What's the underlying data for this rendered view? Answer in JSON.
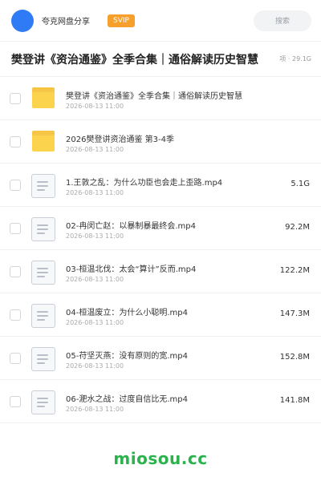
{
  "header": {
    "sharer_name": "夸克网盘分享",
    "vip_badge": "SVIP",
    "search_placeholder": "搜索",
    "avatar_color": "#2f7bf6"
  },
  "share": {
    "title": "樊登讲《资治通鉴》全季合集｜通俗解读历史智慧",
    "meta": "项 · 29.1G"
  },
  "files": [
    {
      "type": "folder",
      "icon": "folder-icon",
      "name": "樊登讲《资治通鉴》全季合集｜通俗解读历史智慧",
      "date": "2026-08-13 11:00",
      "size": ""
    },
    {
      "type": "folder",
      "icon": "folder-icon",
      "name": "2026樊登讲资治通鉴 第3-4季",
      "date": "2026-08-13 11:00",
      "size": ""
    },
    {
      "type": "file",
      "icon": "document-icon",
      "name": "1.王敦之乱：为什么功臣也会走上歪路.mp4",
      "date": "2026-08-13 11:00",
      "size": "5.1G"
    },
    {
      "type": "file",
      "icon": "document-icon",
      "name": "02-冉闵亡赵：以暴制暴最终会.mp4",
      "date": "2026-08-13 11:00",
      "size": "92.2M"
    },
    {
      "type": "file",
      "icon": "document-icon",
      "name": "03-桓温北伐：太会“算计”反而.mp4",
      "date": "2026-08-13 11:00",
      "size": "122.2M"
    },
    {
      "type": "file",
      "icon": "document-icon",
      "name": "04-桓温废立：为什么小聪明.mp4",
      "date": "2026-08-13 11:00",
      "size": "147.3M"
    },
    {
      "type": "file",
      "icon": "document-icon",
      "name": "05-苻坚灭燕：没有原则的宽.mp4",
      "date": "2026-08-13 11:00",
      "size": "152.8M"
    },
    {
      "type": "file",
      "icon": "document-icon",
      "name": "06-淝水之战：过度自信比无.mp4",
      "date": "2026-08-13 11:00",
      "size": "141.8M"
    }
  ],
  "footer": {
    "watermark": "miosou.cc",
    "watermark_color": "#2bb24c"
  },
  "colors": {
    "folder": "#fcd34d",
    "vip": "#f6a02b"
  }
}
